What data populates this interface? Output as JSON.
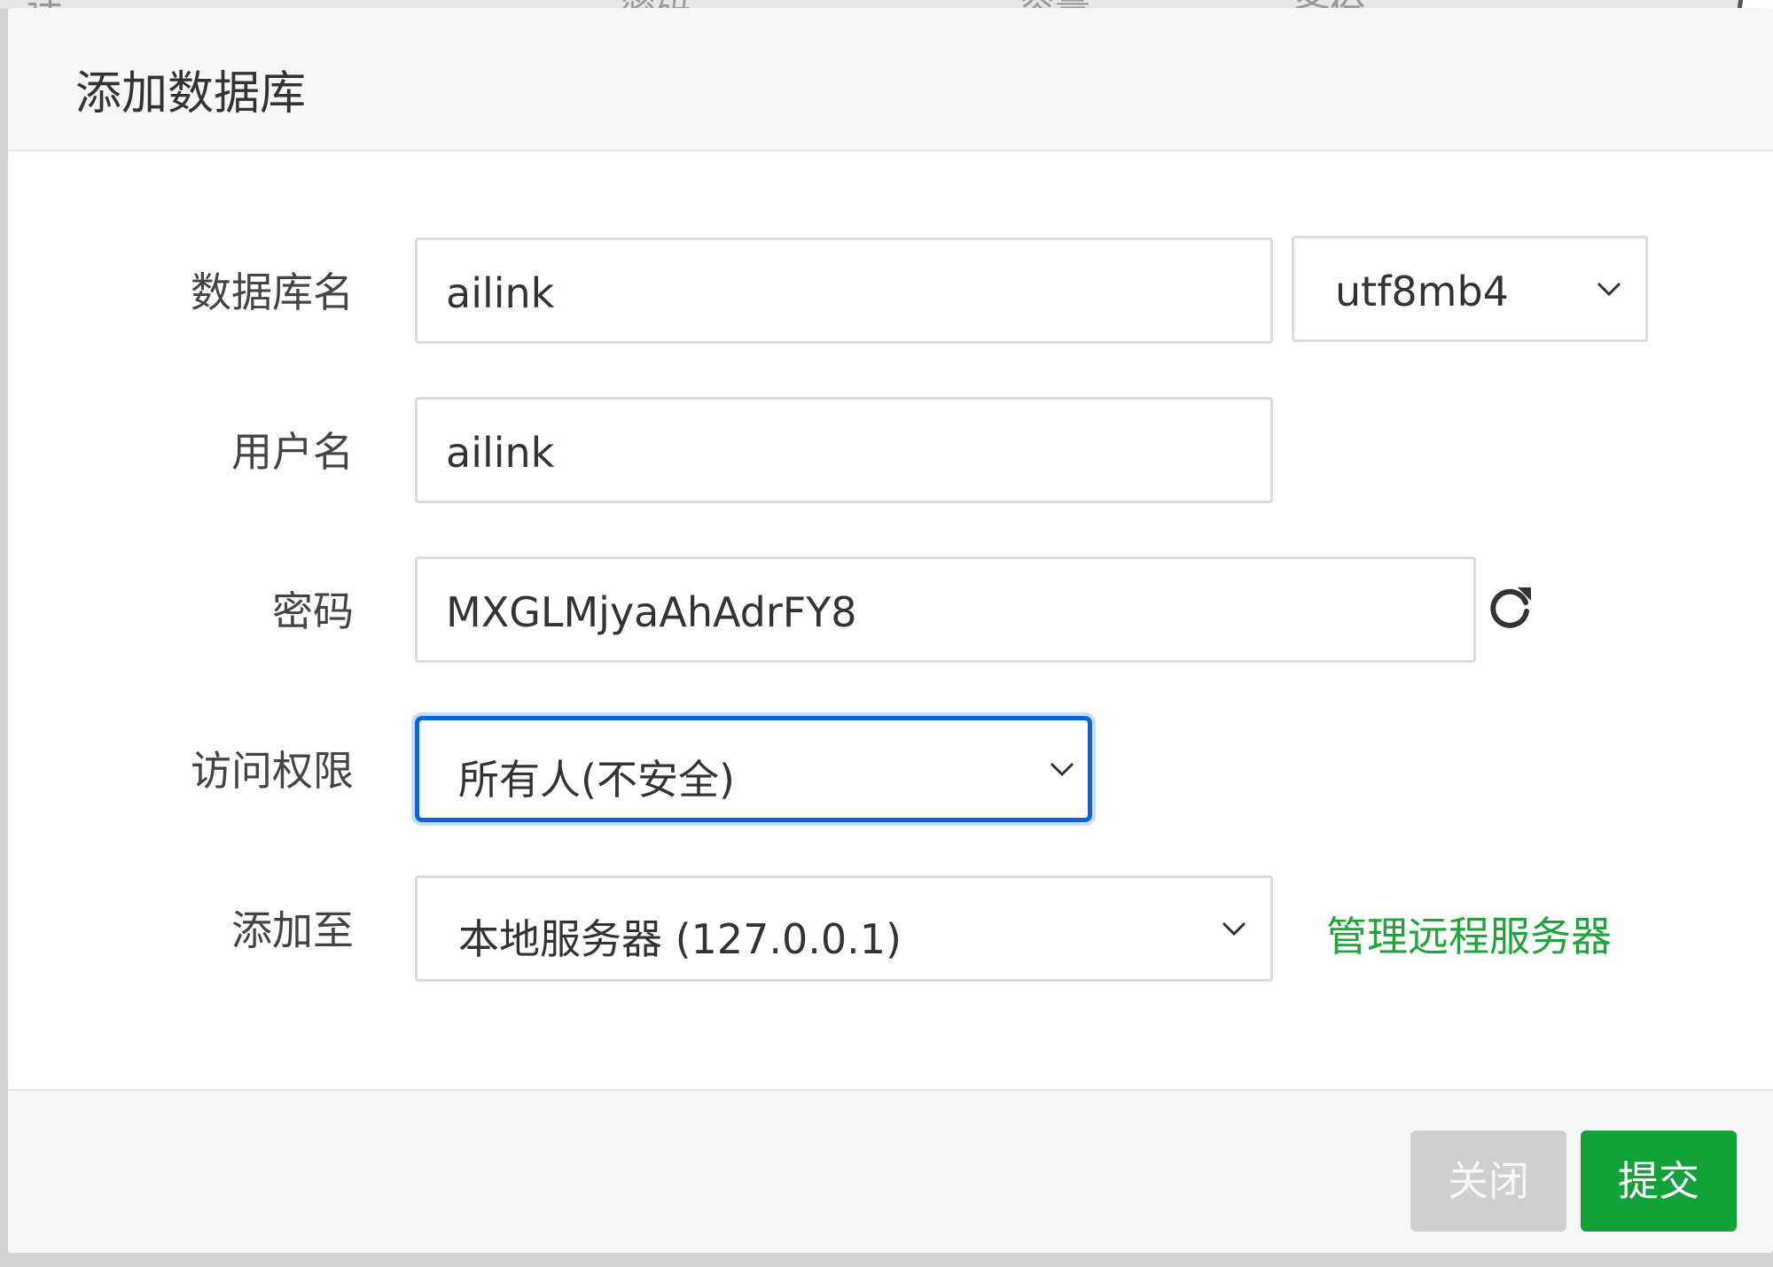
{
  "background": {
    "header_fragments": [
      "计",
      "密码",
      "容量",
      "备份"
    ]
  },
  "modal": {
    "title": "添加数据库",
    "fields": {
      "db_name": {
        "label": "数据库名",
        "value": "ailink"
      },
      "charset": {
        "value": "utf8mb4"
      },
      "username": {
        "label": "用户名",
        "value": "ailink"
      },
      "password": {
        "label": "密码",
        "value": "MXGLMjyaAhAdrFY8"
      },
      "access": {
        "label": "访问权限",
        "value": "所有人(不安全)"
      },
      "add_to": {
        "label": "添加至",
        "value": "本地服务器 (127.0.0.1)"
      }
    },
    "manage_remote_link": "管理远程服务器",
    "buttons": {
      "close": "关闭",
      "submit": "提交"
    }
  },
  "colors": {
    "accent_green": "#20a53a",
    "submit_green": "#12a23a",
    "focus_blue": "#0a66d9",
    "disabled_gray": "#cfcfcf"
  },
  "icons": [
    "refresh-icon",
    "chevron-down-icon",
    "close-circle-icon"
  ]
}
